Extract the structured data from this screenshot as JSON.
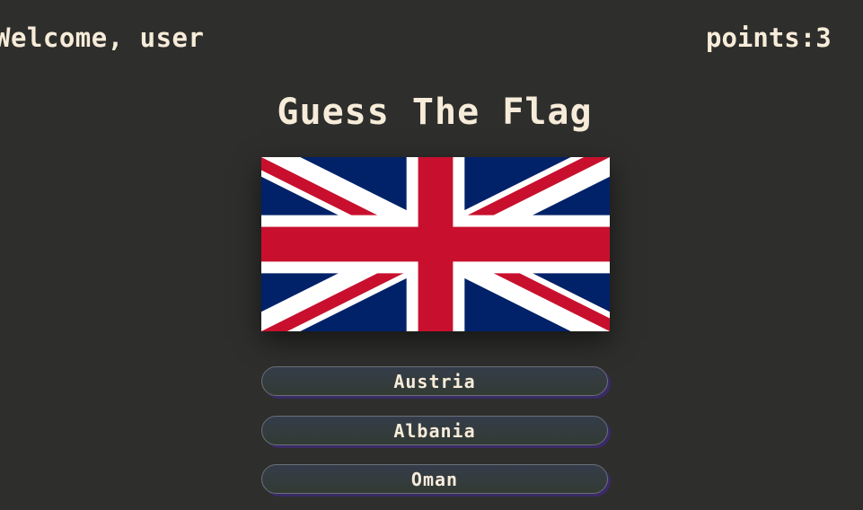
{
  "header": {
    "welcome_text": "Welcome, user",
    "points_text": "points:3"
  },
  "game": {
    "title": "Guess The Flag",
    "flag_icon": "united-kingdom-flag",
    "options": [
      {
        "label": "Austria"
      },
      {
        "label": "Albania"
      },
      {
        "label": "Oman"
      }
    ]
  },
  "colors": {
    "background": "#2e2e2c",
    "text": "#f7ecd9",
    "flag_blue": "#012169",
    "flag_red": "#c8102e",
    "flag_white": "#ffffff",
    "button_shadow": "#3a2a66"
  }
}
